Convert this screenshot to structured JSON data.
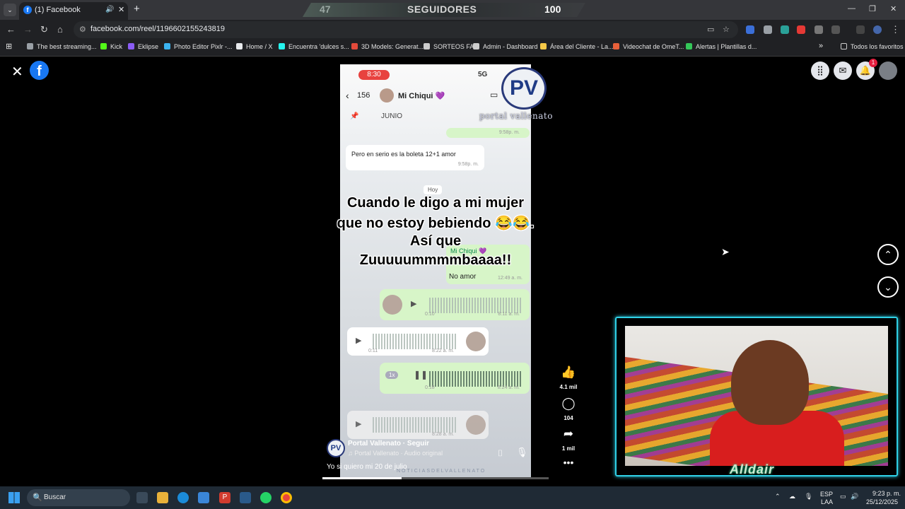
{
  "browser": {
    "tab_title": "(1) Facebook",
    "tab_favicon": "f",
    "url": "facebook.com/reel/1196602155243819",
    "stream_banner": {
      "left_value": "47",
      "label": "SEGUIDORES",
      "right_value": "100"
    },
    "bookmarks": [
      {
        "label": "The best streaming...",
        "color": "#9aa0a6"
      },
      {
        "label": "Kick",
        "color": "#53fc18"
      },
      {
        "label": "Eklipse",
        "color": "#8b5cf6"
      },
      {
        "label": "Photo Editor Pixlr -...",
        "color": "#3bb3f0"
      },
      {
        "label": "Home / X",
        "color": "#e8eaed"
      },
      {
        "label": "Encuentra 'dulces s...",
        "color": "#25f4ee"
      },
      {
        "label": "3D Models: Generat...",
        "color": "#e34a3b"
      },
      {
        "label": "SORTEOS FA",
        "color": "#cccccc"
      },
      {
        "label": "Admin - Dashboard",
        "color": "#cccccc"
      },
      {
        "label": "Área del Cliente - La...",
        "color": "#f7c948"
      },
      {
        "label": "Videochat de OmeT...",
        "color": "#e8603a"
      },
      {
        "label": "Alertas | Plantillas d...",
        "color": "#34c759"
      }
    ],
    "all_bookmarks_label": "Todos los favoritos"
  },
  "facebook": {
    "logo": "f",
    "notification_count": "1",
    "reel": {
      "phone_time": "8:30",
      "phone_signal": "5G",
      "chat_count": "156",
      "chat_name": "Mi Chiqui 💜",
      "pinned_label": "JUNIO",
      "time_1": "9:58p. m.",
      "message_1": "Pero en serio es la boleta 12+1 amor",
      "time_2": "9:58p. m.",
      "date_label": "Hoy",
      "reply_name": "Mi Chiqui 💜",
      "reply_text": "No amor",
      "reply_time": "12:49 a. m.",
      "audio_1_duration": "0:10",
      "audio_1_time": "8:11 a. m.",
      "audio_2_duration": "0:11",
      "audio_2_time": "8:22 a. m.",
      "audio_3_speed": "1x",
      "audio_3_duration": "0:18",
      "audio_3_time": "8:24 a. m.",
      "audio_4_time": "8:28 a. m.",
      "overlay_logo": "PV",
      "overlay_brand": "portal vallenato",
      "caption_lines": [
        "Cuando le digo a mi mujer",
        "que no estoy bebiendo 😂😂.",
        "Así que",
        "Zuuuuummmmbaaaa!!"
      ],
      "author": "Portal Vallenato · Seguir",
      "audio_source": "Portal Vallenato · Audio original",
      "description": "Yo si quiero mi 20 de julio",
      "watermark": "NOTICIASDELVALLENATO",
      "progress_fraction": 0.35,
      "likes": "4.1 mil",
      "comments": "104",
      "shares": "1 mil"
    }
  },
  "stream_overlay": {
    "name": "Alldair"
  },
  "taskbar": {
    "search_label": "Buscar",
    "lang_top": "ESP",
    "lang_bottom": "LAA",
    "time": "9:23 p. m.",
    "date": "25/12/2025"
  }
}
